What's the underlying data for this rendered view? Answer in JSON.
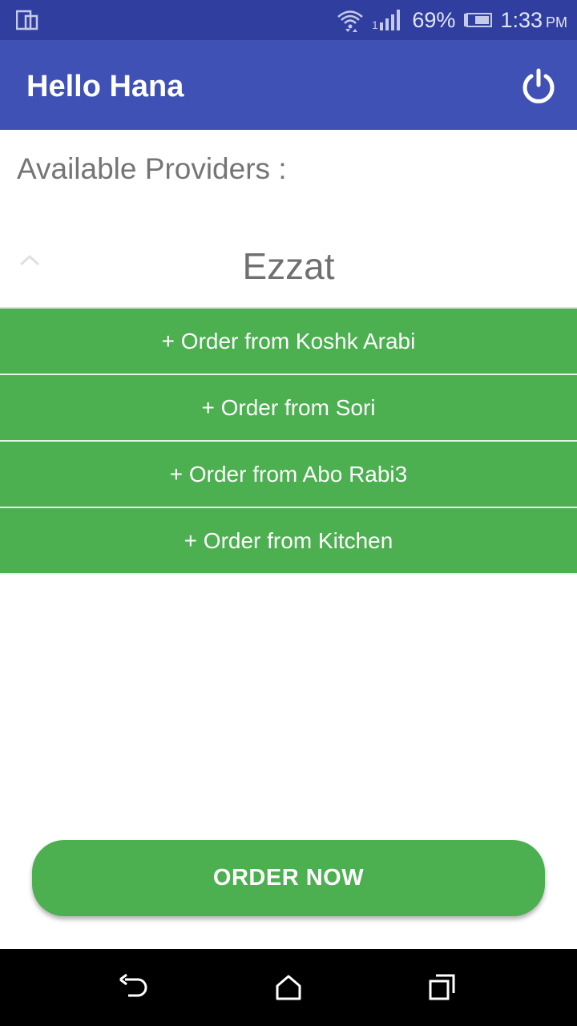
{
  "status_bar": {
    "battery": "69%",
    "time": "1:33",
    "time_suffix": "PM"
  },
  "app_bar": {
    "title": "Hello Hana",
    "action_icon": "power-icon"
  },
  "content": {
    "section_label": "Available Providers :",
    "provider": {
      "name": "Ezzat",
      "expanded": true,
      "orders": [
        "+ Order from Koshk Arabi",
        "+ Order from Sori",
        "+ Order from Abo Rabi3",
        "+ Order from Kitchen"
      ]
    }
  },
  "order_button": {
    "label": "ORDER NOW"
  },
  "colors": {
    "status_bar": "#303f9f",
    "app_bar": "#3f51b5",
    "accent_green": "#4caf50"
  }
}
